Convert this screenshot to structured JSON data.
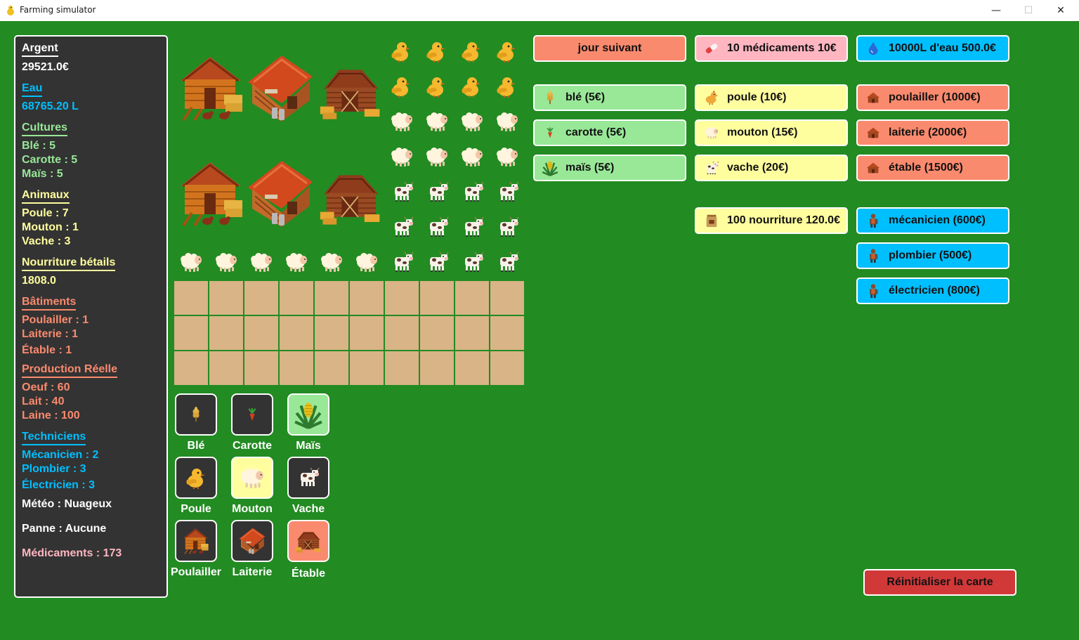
{
  "window": {
    "title": "Farming simulator",
    "minimize": "—",
    "maximize": "☐",
    "close": "✕"
  },
  "colors": {
    "background": "#228b22",
    "panel": "#333333",
    "white_text": "#ffffff",
    "yellow_text": "#fffe9e",
    "cyan_text": "#00bfff",
    "light_green_text": "#98e898",
    "salmon_text": "#fa8a6e",
    "pink_text": "#ffb6c1",
    "soil": "#d9b487"
  },
  "stats": {
    "argent": {
      "title": "Argent",
      "value": "29521.0€"
    },
    "eau": {
      "title": "Eau",
      "value": "68765.20 L"
    },
    "cultures": {
      "title": "Cultures",
      "items": [
        "Blé : 5",
        "Carotte : 5",
        "Maïs : 5"
      ]
    },
    "animaux": {
      "title": "Animaux",
      "items": [
        "Poule : 7",
        "Mouton : 1",
        "Vache : 3"
      ]
    },
    "nourriture": {
      "title": "Nourriture bétails",
      "value": "1808.0"
    },
    "batiments": {
      "title": "Bâtiments",
      "items": [
        "Poulailler : 1",
        "Laiterie : 1",
        "Étable : 1"
      ]
    },
    "production": {
      "title": "Production Réelle",
      "items": [
        "Oeuf : 60",
        "Lait : 40",
        "Laine : 100"
      ]
    },
    "techniciens": {
      "title": "Techniciens",
      "items": [
        "Mécanicien : 2",
        "Plombier : 3",
        "Électricien : 3"
      ]
    },
    "meteo": "Météo : Nuageux",
    "panne": "Panne : Aucune",
    "medicaments": "Médicaments : 173"
  },
  "farm": {
    "buildings": [
      "chicken-coop",
      "dairy",
      "barn",
      "chicken-coop",
      "dairy",
      "barn"
    ],
    "animals_on_map": {
      "chickens": 8,
      "sheep_grid": 8,
      "cows": 12,
      "sheep_row": 6
    },
    "soil_grid": {
      "rows": 3,
      "cols": 10
    }
  },
  "selectors": [
    {
      "label": "Blé",
      "icon": "wheat-icon",
      "selected": false
    },
    {
      "label": "Carotte",
      "icon": "carrot-icon",
      "selected": false
    },
    {
      "label": "Maïs",
      "icon": "corn-icon",
      "selected": true
    },
    {
      "label": "Poule",
      "icon": "chicken-icon",
      "selected": false
    },
    {
      "label": "Mouton",
      "icon": "sheep-icon",
      "selected": true
    },
    {
      "label": "Vache",
      "icon": "cow-icon",
      "selected": false
    },
    {
      "label": "Poulailler",
      "icon": "chicken-coop-icon",
      "selected": false
    },
    {
      "label": "Laiterie",
      "icon": "dairy-icon",
      "selected": false
    },
    {
      "label": "Étable",
      "icon": "barn-icon",
      "selected": true
    }
  ],
  "actions": {
    "next_day": "jour suivant",
    "medicines": "10 médicaments 10€",
    "water": "10000L d'eau 500.0€",
    "food": "100 nourriture 120.0€",
    "reset": "Réinitialiser la carte"
  },
  "shop": {
    "crops": [
      "blé (5€)",
      "carotte (5€)",
      "maïs (5€)"
    ],
    "animals": [
      "poule (10€)",
      "mouton (15€)",
      "vache (20€)"
    ],
    "buildings": [
      "poulailler (1000€)",
      "laiterie (2000€)",
      "étable (1500€)"
    ],
    "technicians": [
      "mécanicien (600€)",
      "plombier (500€)",
      "électricien (800€)"
    ]
  }
}
